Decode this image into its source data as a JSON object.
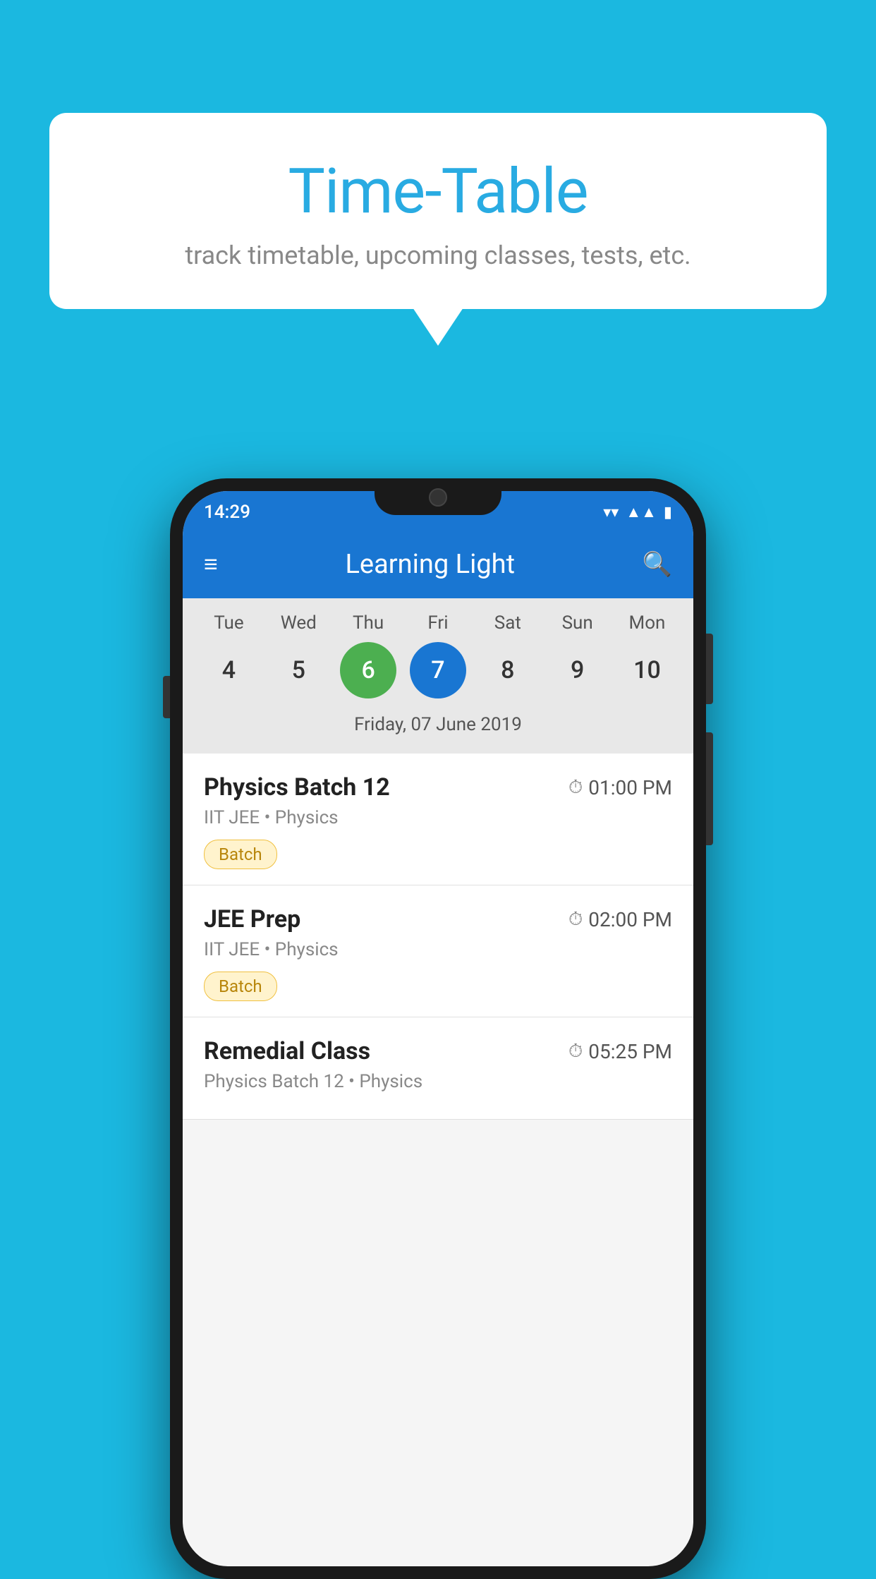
{
  "background_color": "#1BB8E0",
  "bubble": {
    "title": "Time-Table",
    "subtitle": "track timetable, upcoming classes, tests, etc."
  },
  "phone": {
    "status_bar": {
      "time": "14:29"
    },
    "app_bar": {
      "title": "Learning Light"
    },
    "calendar": {
      "days": [
        {
          "label": "Tue",
          "number": "4"
        },
        {
          "label": "Wed",
          "number": "5"
        },
        {
          "label": "Thu",
          "number": "6",
          "state": "today"
        },
        {
          "label": "Fri",
          "number": "7",
          "state": "selected"
        },
        {
          "label": "Sat",
          "number": "8"
        },
        {
          "label": "Sun",
          "number": "9"
        },
        {
          "label": "Mon",
          "number": "10"
        }
      ],
      "selected_date_label": "Friday, 07 June 2019"
    },
    "schedule": [
      {
        "title": "Physics Batch 12",
        "time": "01:00 PM",
        "subtitle": "IIT JEE • Physics",
        "tag": "Batch"
      },
      {
        "title": "JEE Prep",
        "time": "02:00 PM",
        "subtitle": "IIT JEE • Physics",
        "tag": "Batch"
      },
      {
        "title": "Remedial Class",
        "time": "05:25 PM",
        "subtitle": "Physics Batch 12 • Physics",
        "tag": null
      }
    ]
  }
}
